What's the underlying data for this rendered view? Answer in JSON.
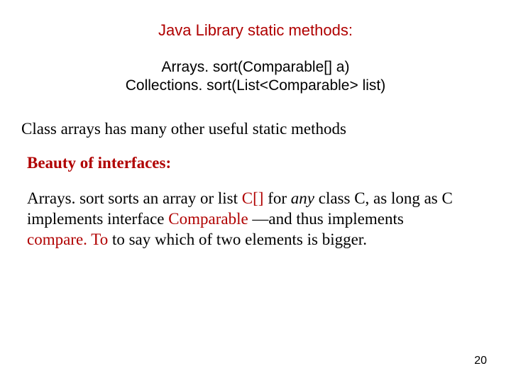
{
  "title": "Java Library static methods:",
  "code": {
    "line1": "Arrays. sort(Comparable[] a)",
    "line2": "Collections. sort(List<Comparable> list)"
  },
  "serif_line": "Class arrays has many other useful static methods",
  "subheading": "Beauty of interfaces:",
  "paragraph": {
    "t1": "Arrays. sort sorts an array or list ",
    "t2_red": "C[]",
    "t3": " for ",
    "t4_italic": "any",
    "t5": " class C, as long as C implements interface ",
    "t6_red": "Comparable",
    "t7": " —and thus implements ",
    "t8_red": "compare. To",
    "t9": " to say which of two elements is bigger."
  },
  "page_number": "20"
}
